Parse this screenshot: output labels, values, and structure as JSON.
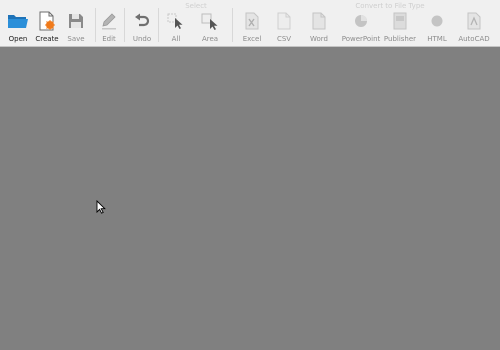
{
  "toolbar": {
    "open": "Open",
    "create": "Create",
    "save": "Save",
    "edit": "Edit",
    "undo": "Undo",
    "select_group": "Select",
    "all": "All",
    "area": "Area",
    "convert_group": "Convert to File Type",
    "excel": "Excel",
    "csv": "CSV",
    "word": "Word",
    "powerpoint": "PowerPoint",
    "publisher": "Publisher",
    "html": "HTML",
    "autocad": "AutoCAD"
  },
  "colors": {
    "toolbar_bg": "#f0f0f0",
    "workspace_bg": "#808080",
    "folder_blue": "#2b8fd9",
    "create_orange": "#f07a1a"
  }
}
